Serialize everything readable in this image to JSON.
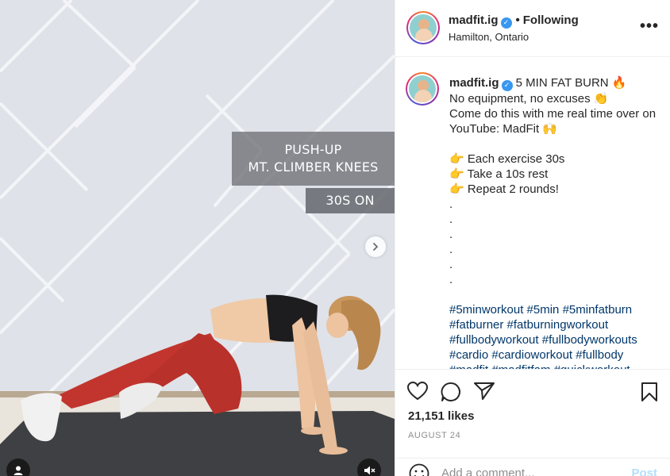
{
  "video": {
    "exercise_lines": [
      "PUSH-UP",
      "MT. CLIMBER KNEES"
    ],
    "timer": "30S ON"
  },
  "header": {
    "username": "madfit.ig",
    "verified_glyph": "✓",
    "separator": "•",
    "follow_status": "Following",
    "location": "Hamilton, Ontario",
    "more_glyph": "•••"
  },
  "caption": {
    "username": "madfit.ig",
    "verified_glyph": "✓",
    "lines": [
      "5 MIN FAT BURN 🔥",
      "No equipment, no excuses 👏",
      "Come do this with me real time over on",
      "YouTube: MadFit 🙌",
      "",
      "👉 Each exercise 30s",
      "👉 Take a 10s rest",
      "👉 Repeat 2 rounds!",
      ".",
      ".",
      ".",
      ".",
      ".",
      "."
    ],
    "hashtag_lines": [
      "#5minworkout #5min #5minfatburn",
      "#fatburner #fatburningworkout",
      "#fullbodyworkout #fullbodyworkouts",
      "#cardio #cardioworkout #fullbody",
      "#madfit #madfitfam #quickworkout"
    ]
  },
  "actions": {
    "icons": [
      "heart-icon",
      "comment-icon",
      "share-icon",
      "bookmark-icon"
    ],
    "likes": "21,151 likes",
    "date": "AUGUST 24"
  },
  "comment": {
    "placeholder": "Add a comment...",
    "post_label": "Post"
  },
  "colors": {
    "accent_blue": "#3897f0",
    "hashtag": "#00376b",
    "post_disabled": "#b2dffc",
    "legging_red": "#c1352e"
  }
}
